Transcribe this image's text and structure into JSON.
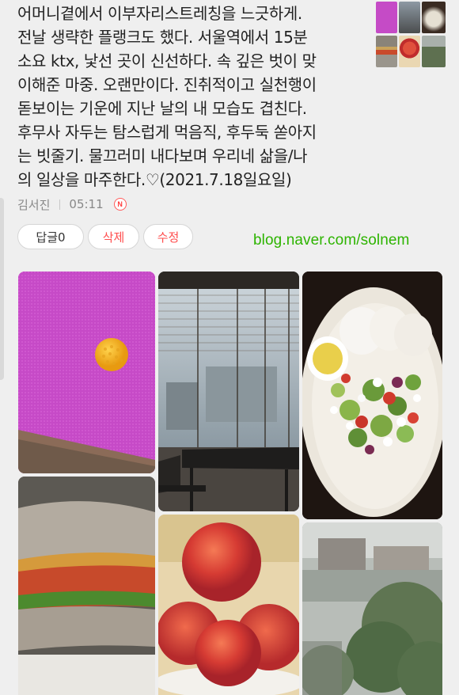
{
  "post": {
    "body": "어머니곁에서 이부자리스트레칭을 느긋하게.\n전날 생략한 플랭크도 했다. 서울역에서 15분\n소요 ktx, 낯선 곳이 신선하다. 속 깊은 벗이 맞\n이해준 마중. 오랜만이다. 진취적이고 실천행이\n돋보이는 기운에 지난 날의 내 모습도 겹친다.\n후무사 자두는 탐스럽게 먹음직, 후두둑 쏟아지\n는 빗줄기. 물끄러미 내다보며 우리네 삶을/나\n의 일상을 마주한다.♡(2021.7.18일요일)"
  },
  "meta": {
    "author": "김서진",
    "time": "05:11",
    "new_badge": "N"
  },
  "actions": {
    "reply": "답글0",
    "delete": "삭제",
    "edit": "수정"
  },
  "blog_url": "blog.naver.com/solnem",
  "colors": {
    "accent_green": "#2db400",
    "delete_red": "#ff4d4d",
    "text": "#222222",
    "meta_gray": "#888888"
  },
  "photos": [
    {
      "subject": "pink yoga mat with orange massage ball"
    },
    {
      "subject": "cafe interior with window blinds and tables"
    },
    {
      "subject": "salad plate with cheese, tomato and pancakes"
    },
    {
      "subject": "tuna sandwich"
    },
    {
      "subject": "pile of red plums"
    },
    {
      "subject": "rainy view of rooftops and trees"
    }
  ],
  "thumbnails": [
    {
      "subject": "pink thumbnail"
    },
    {
      "subject": "cafe thumbnail"
    },
    {
      "subject": "salad thumbnail"
    },
    {
      "subject": "sandwich thumbnail"
    },
    {
      "subject": "plum thumbnail"
    },
    {
      "subject": "garden thumbnail"
    }
  ]
}
